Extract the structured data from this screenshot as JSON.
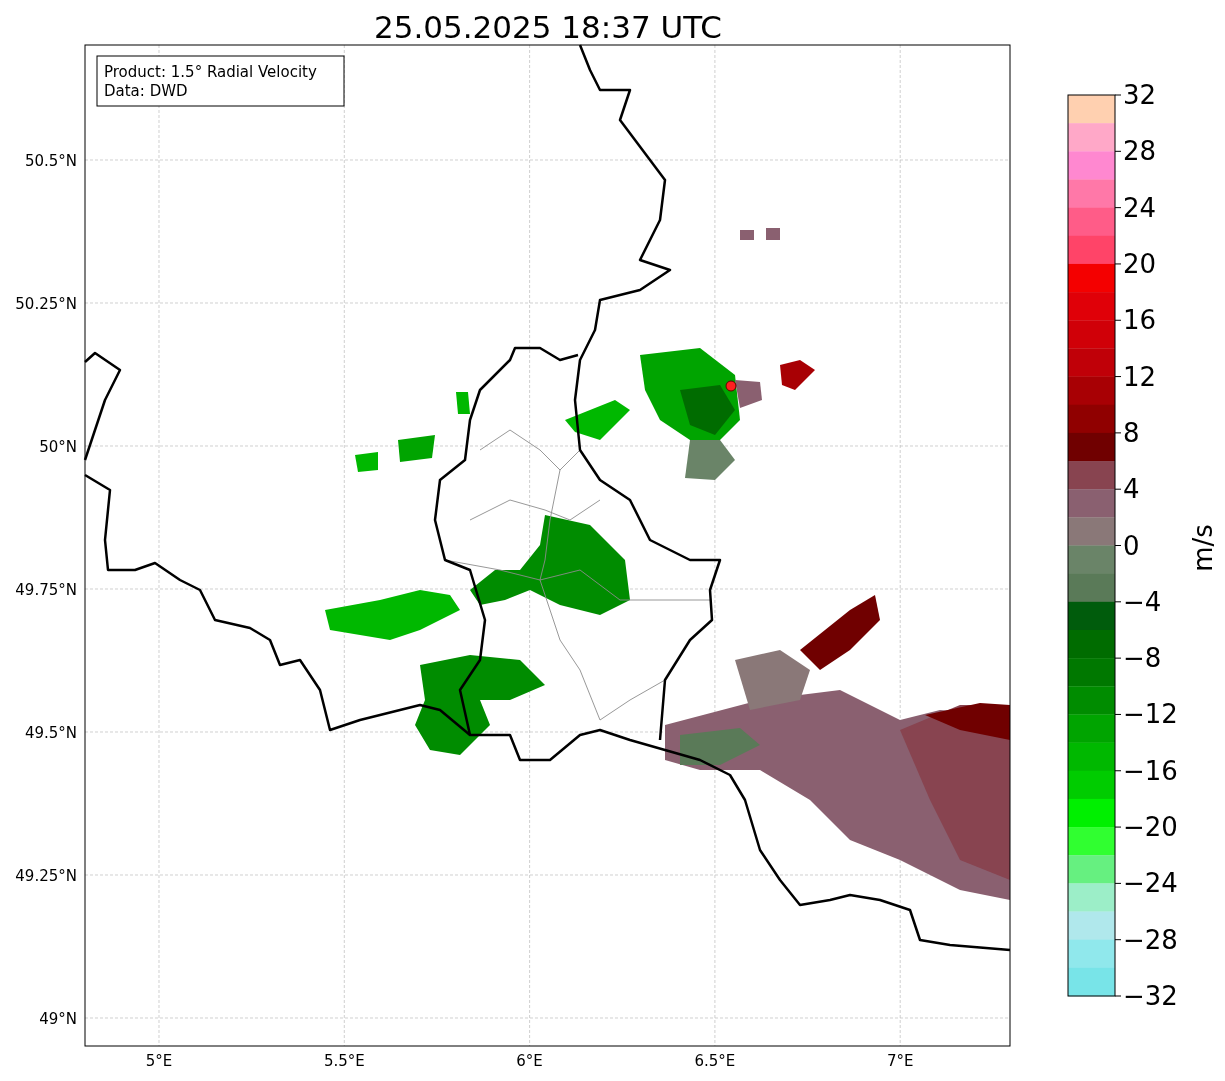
{
  "title": "25.05.2025 18:37 UTC",
  "legend": [
    "Product: 1.5° Radial Velocity",
    "Data: DWD"
  ],
  "lat_ticks": [
    "50.5°N",
    "50.25°N",
    "50°N",
    "49.75°N",
    "49.5°N",
    "49.25°N",
    "49°N"
  ],
  "lon_ticks": [
    "5°E",
    "5.5°E",
    "6°E",
    "6.5°E",
    "7°E"
  ],
  "colorbar": {
    "label": "m/s",
    "ticks": [
      "32",
      "28",
      "24",
      "20",
      "16",
      "12",
      "8",
      "4",
      "0",
      "−4",
      "−8",
      "−12",
      "−16",
      "−20",
      "−24",
      "−28",
      "−32"
    ],
    "bands": [
      {
        "color": "#ffd0b0"
      },
      {
        "color": "#ffa8c8"
      },
      {
        "color": "#ff88d0"
      },
      {
        "color": "#ff78a8"
      },
      {
        "color": "#ff5c88"
      },
      {
        "color": "#ff4468"
      },
      {
        "color": "#f40000"
      },
      {
        "color": "#e00008"
      },
      {
        "color": "#d00008"
      },
      {
        "color": "#c00008"
      },
      {
        "color": "#a80004"
      },
      {
        "color": "#900000"
      },
      {
        "color": "#700000"
      },
      {
        "color": "#884450"
      },
      {
        "color": "#8a6070"
      },
      {
        "color": "#8a7878"
      },
      {
        "color": "#6a8468"
      },
      {
        "color": "#5a7a58"
      },
      {
        "color": "#005c0c"
      },
      {
        "color": "#006c00"
      },
      {
        "color": "#007800"
      },
      {
        "color": "#008c00"
      },
      {
        "color": "#00a400"
      },
      {
        "color": "#00b800"
      },
      {
        "color": "#00cc00"
      },
      {
        "color": "#00f000"
      },
      {
        "color": "#30ff30"
      },
      {
        "color": "#66f080"
      },
      {
        "color": "#9ceec8"
      },
      {
        "color": "#b0e8ec"
      },
      {
        "color": "#90e8ec"
      },
      {
        "color": "#78e4e8"
      }
    ]
  }
}
